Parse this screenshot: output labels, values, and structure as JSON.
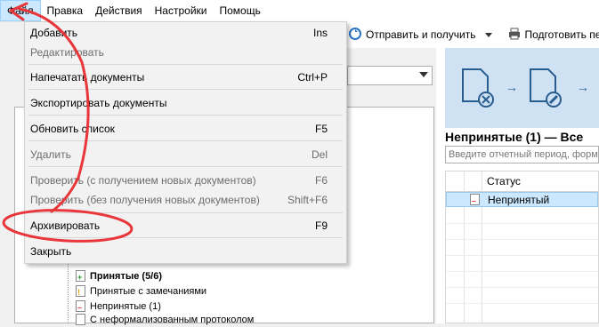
{
  "menubar": {
    "items": [
      {
        "label": "Файл",
        "active": true
      },
      {
        "label": "Правка",
        "active": false
      },
      {
        "label": "Действия",
        "active": false
      },
      {
        "label": "Настройки",
        "active": false
      },
      {
        "label": "Помощь",
        "active": false
      }
    ]
  },
  "toolbar": {
    "send_receive_label": "Отправить и получить",
    "prepare_print_label": "Подготовить печатну"
  },
  "file_menu": {
    "items": [
      {
        "label": "Добавить",
        "shortcut": "Ins",
        "disabled": false
      },
      {
        "label": "Редактировать",
        "shortcut": "",
        "disabled": true
      },
      {
        "label": "Напечатать документы",
        "shortcut": "Ctrl+P",
        "disabled": false
      },
      {
        "label": "Экспортировать документы",
        "shortcut": "",
        "disabled": false
      },
      {
        "label": "Обновить список",
        "shortcut": "F5",
        "disabled": false
      },
      {
        "label": "Удалить",
        "shortcut": "Del",
        "disabled": true
      },
      {
        "label": "Проверить (с получением новых документов)",
        "shortcut": "F6",
        "disabled": true
      },
      {
        "label": "Проверить (без получения новых документов)",
        "shortcut": "Shift+F6",
        "disabled": true
      },
      {
        "label": "Архивировать",
        "shortcut": "F9",
        "disabled": false
      },
      {
        "label": "Закрыть",
        "shortcut": "",
        "disabled": false
      }
    ]
  },
  "tree": {
    "items": [
      {
        "label": "Принятые (5/6)",
        "bold": true,
        "icon": "doc-accepted-icon"
      },
      {
        "label": "Принятые с замечаниями",
        "bold": false,
        "icon": "doc-warning-icon"
      },
      {
        "label": "Непринятые (1)",
        "bold": false,
        "icon": "doc-rejected-icon"
      },
      {
        "label": "С неформализованным протоколом",
        "bold": false,
        "icon": "doc-icon"
      }
    ]
  },
  "right_panel": {
    "title": "Непринятые (1)  — Все",
    "search_placeholder": "Введите отчетный период, форму",
    "grid": {
      "column_status": "Статус",
      "rows": [
        {
          "status": "Непринятый"
        }
      ]
    }
  },
  "colors": {
    "menu_highlight": "#cce8ff",
    "banner": "#cfe2f3",
    "annotation": "#e8363a"
  }
}
